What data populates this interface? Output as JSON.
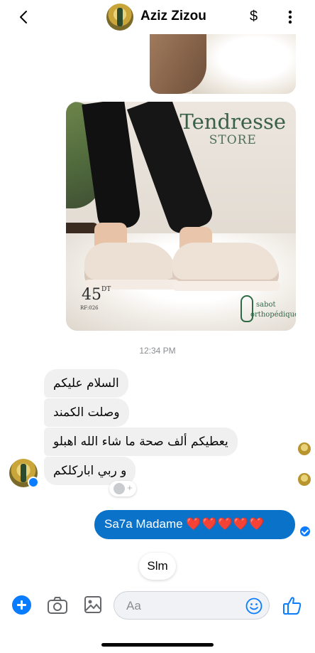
{
  "header": {
    "back_icon": "chevron-left-icon",
    "contact_name": "Aziz Zizou",
    "payment_icon_glyph": "$",
    "more_icon": "vertical-dots-icon"
  },
  "product_image": {
    "brand_name": "Tendresse",
    "brand_sub": "STORE",
    "price": "45",
    "currency": "DT",
    "ref": "RF:026",
    "logo_line1": "sabot",
    "logo_line2": "orthopédique"
  },
  "conversation": {
    "timestamp": "12:34 PM",
    "incoming": [
      "السلام عليكم",
      "وصلت الكمند",
      "يعطيكم ألف صحة ما شاء الله اهبلو",
      "و ربي اباركلكم"
    ],
    "outgoing_text": "Sa7a Madame",
    "outgoing_hearts": "❤️❤️❤️❤️❤️",
    "typing_text": "Slm"
  },
  "composer": {
    "placeholder": "Aa",
    "icons": [
      "plus-icon",
      "camera-icon",
      "gallery-icon",
      "emoji-icon",
      "thumbs-up-icon"
    ]
  },
  "colors": {
    "accent": "#0a7cff",
    "outgoing_bubble": "#0b72c9",
    "incoming_bubble": "#f0f0f0",
    "brand_green": "#3a6048"
  }
}
